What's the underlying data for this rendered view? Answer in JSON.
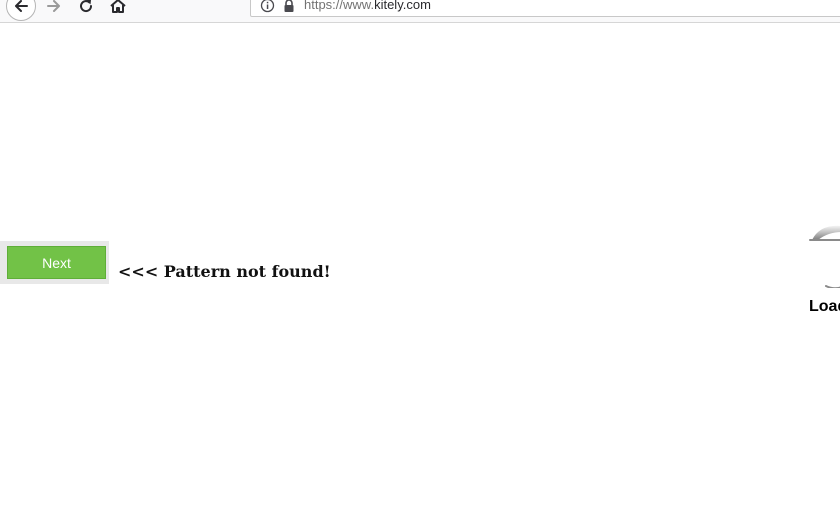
{
  "browser": {
    "url_protocol": "https://www.",
    "url_domain": "kitely.com",
    "icons": {
      "back": "arrow-left-icon",
      "forward": "arrow-right-icon",
      "reload": "reload-icon",
      "home": "home-icon",
      "info": "info-icon",
      "lock": "lock-icon"
    }
  },
  "page": {
    "next_label": "Next",
    "pattern_message": "<<< Pattern not found!",
    "loading_text": "Load"
  },
  "colors": {
    "next_button": "#72c247",
    "next_panel": "#e8e8e8"
  }
}
